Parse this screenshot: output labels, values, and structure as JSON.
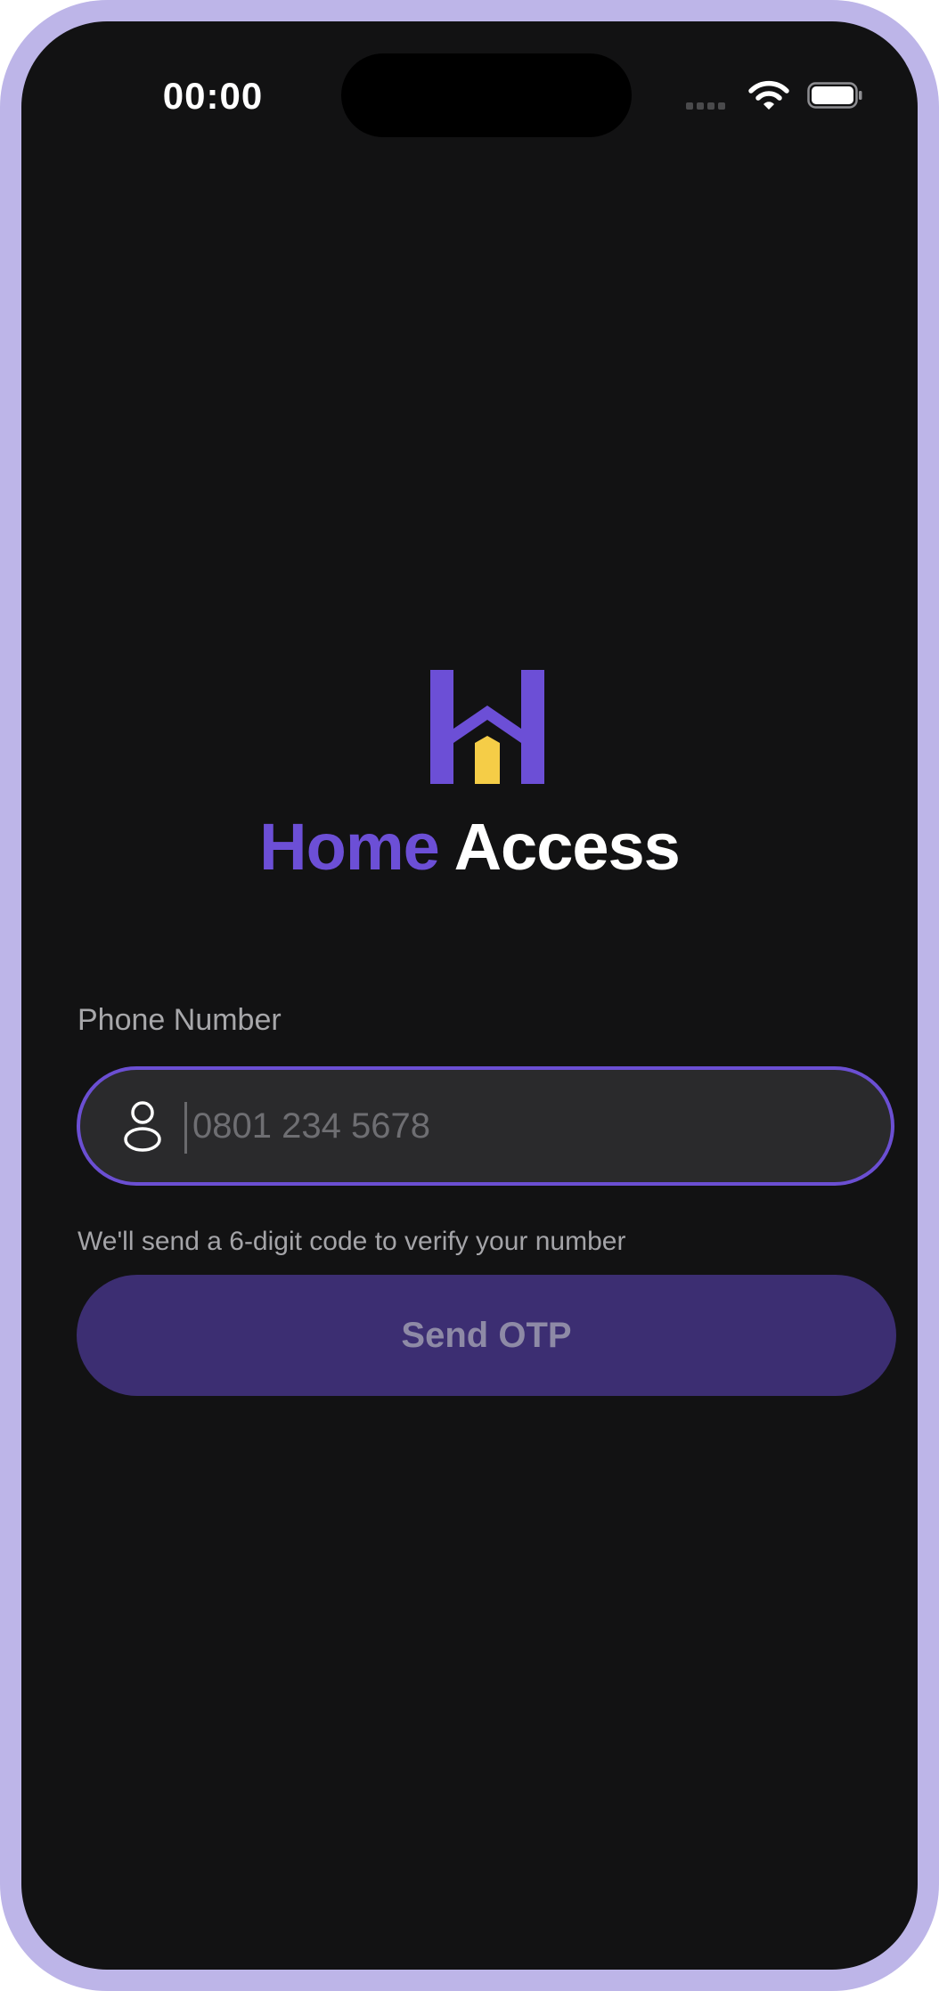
{
  "status_bar": {
    "time": "00:00"
  },
  "brand": {
    "name_part1": "Home",
    "name_part2": "Access",
    "primary_color": "#6C4FD6",
    "accent_color": "#F5CD47"
  },
  "form": {
    "phone_label": "Phone Number",
    "phone_placeholder": "0801 234 5678",
    "phone_value": "",
    "helper_text": "We'll send a 6-digit code to verify your number",
    "submit_label": "Send OTP"
  },
  "icons": {
    "field": "person-icon",
    "status": [
      "signal-icon",
      "wifi-icon",
      "battery-icon"
    ]
  }
}
